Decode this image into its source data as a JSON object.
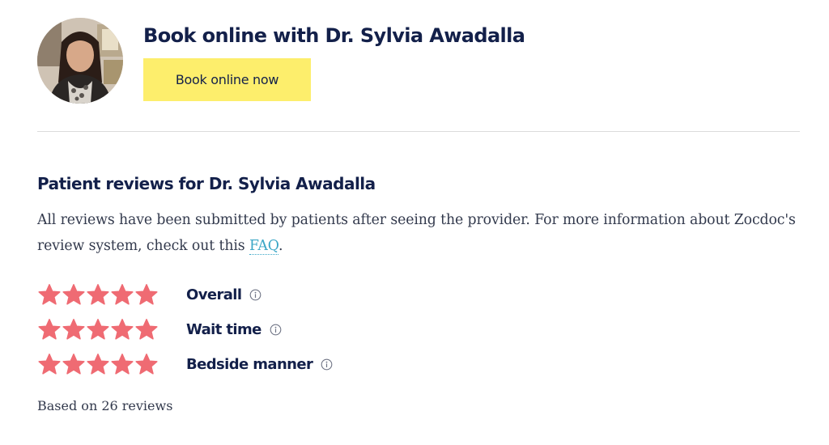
{
  "booking": {
    "avatar_alt": "Dr. Sylvia Awadalla",
    "title": "Book online with Dr. Sylvia Awadalla",
    "button_label": "Book online now",
    "button_color": "#fdee6c"
  },
  "reviews": {
    "title": "Patient reviews for Dr. Sylvia Awadalla",
    "description_prefix": "All reviews have been submitted by patients after seeing the provider. For more information about Zocdoc's review system, check out this ",
    "faq_label": "FAQ",
    "description_suffix": ".",
    "star_color": "#ef6b73",
    "link_color": "#3aa6c6",
    "ratings": [
      {
        "label": "Overall",
        "stars": 5,
        "max_stars": 5,
        "info_icon": "info-icon"
      },
      {
        "label": "Wait time",
        "stars": 5,
        "max_stars": 5,
        "info_icon": "info-icon"
      },
      {
        "label": "Bedside manner",
        "stars": 5,
        "max_stars": 5,
        "info_icon": "info-icon"
      }
    ],
    "summary": "Based on 26 reviews"
  }
}
